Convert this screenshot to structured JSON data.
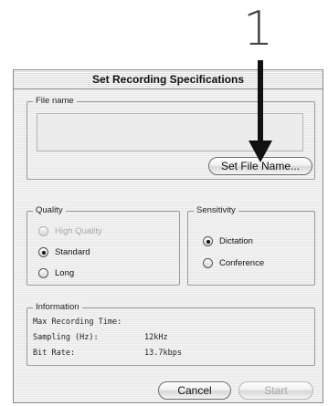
{
  "step_number": "1",
  "dialog": {
    "title": "Set Recording Specifications",
    "file_name": {
      "label": "File name",
      "value": "",
      "set_button": "Set File Name..."
    },
    "quality": {
      "label": "Quality",
      "options": [
        {
          "label": "High Quality",
          "selected": false,
          "enabled": false
        },
        {
          "label": "Standard",
          "selected": true,
          "enabled": true
        },
        {
          "label": "Long",
          "selected": false,
          "enabled": true
        }
      ]
    },
    "sensitivity": {
      "label": "Sensitivity",
      "options": [
        {
          "label": "Dictation",
          "selected": true,
          "enabled": true
        },
        {
          "label": "Conference",
          "selected": false,
          "enabled": true
        }
      ]
    },
    "information": {
      "label": "Information",
      "rows": [
        {
          "label": "Max Recording Time:",
          "value": ""
        },
        {
          "label": "Sampling (Hz):",
          "value": "12kHz"
        },
        {
          "label": "Bit Rate:",
          "value": "13.7kbps"
        }
      ]
    },
    "buttons": {
      "cancel": "Cancel",
      "start": "Start"
    }
  },
  "icons": {
    "annotation_arrow": "down-arrow-icon"
  }
}
